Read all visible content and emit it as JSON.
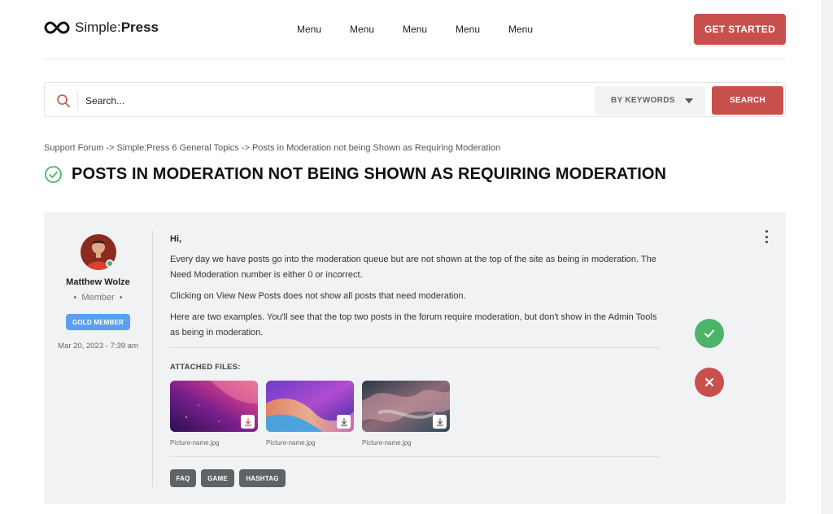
{
  "header": {
    "logo": {
      "brand_light": "Simple:",
      "brand_bold": "Press"
    },
    "nav": [
      "Menu",
      "Menu",
      "Menu",
      "Menu",
      "Menu"
    ],
    "cta_label": "GET STARTED"
  },
  "search": {
    "placeholder": "Search...",
    "filter_selected": "BY KEYWORDS",
    "button_label": "SEARCH"
  },
  "breadcrumb": "Support Forum -> Simple:Press 6 General Topics -> Posts in Moderation not being Shown as Requiring Moderation",
  "topic": {
    "title": "POSTS IN MODERATION NOT BEING SHOWN AS REQUIRING MODERATION",
    "status_icon": "check-circle-icon"
  },
  "post": {
    "author": {
      "name": "Matthew Wolze",
      "role": "Member",
      "badge": "GOLD MEMBER",
      "online": true
    },
    "date": "Mar 20, 2023 - 7:39 am",
    "greeting": "Hi,",
    "paragraphs": [
      "Every day we have posts go into the moderation queue but are not shown at the top of the site as being in moderation. The Need Moderation number is either 0 or incorrect.",
      "Clicking on View New Posts does not show all posts that need moderation.",
      "Here are two examples. You'll see that the top two posts in the forum require moderation, but don't show in the Admin Tools as being in moderation."
    ],
    "attachments_label": "ATTACHED FILES:",
    "attachments": [
      {
        "name": "Picture-name.jpg"
      },
      {
        "name": "Picture-name.jpg"
      },
      {
        "name": "Picture-name.jpg"
      }
    ],
    "tags": [
      "FAQ",
      "GAME",
      "HASHTAG"
    ]
  },
  "colors": {
    "accent": "#c8504c",
    "approve": "#4cb46a",
    "badge": "#5b9ff0",
    "tag": "#5f6366",
    "card_bg": "#f1f2f3"
  }
}
